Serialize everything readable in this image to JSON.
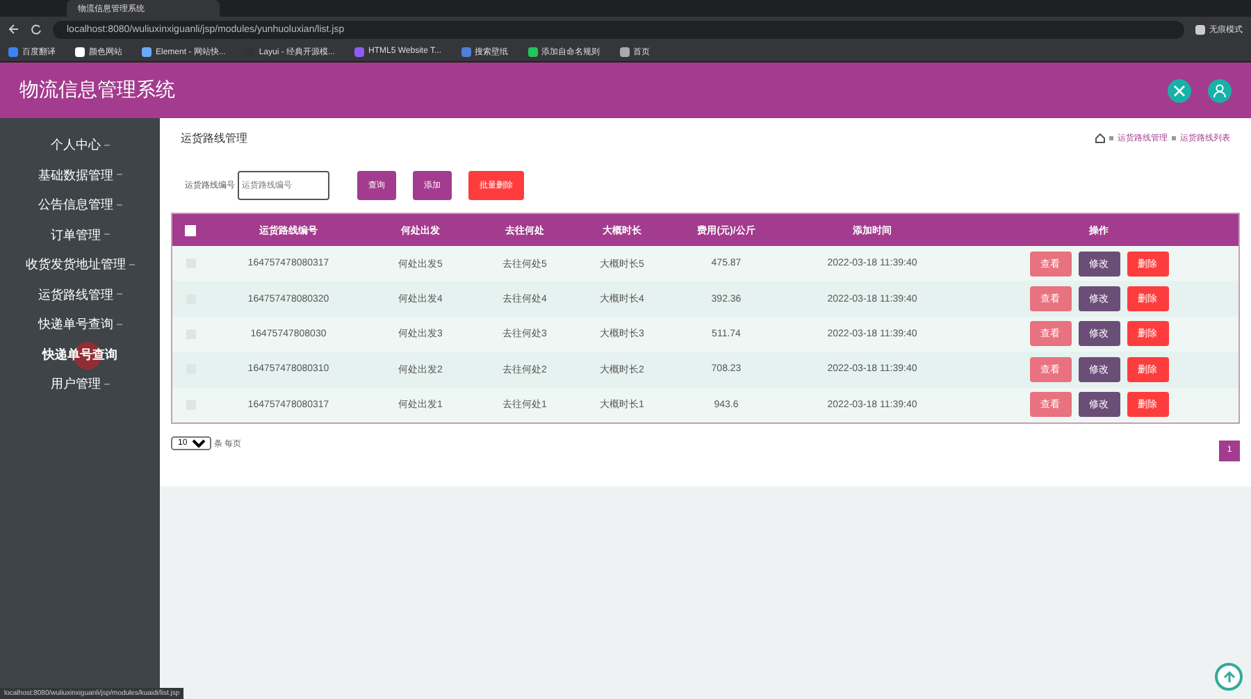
{
  "browser": {
    "tab_title": "物流信息管理系统",
    "address": "localhost:8080/wuliuxinxiguanli/jsp/modules/yunhuoluxian/list.jsp",
    "profile_label": "无痕模式",
    "bookmarks": [
      "百度翻译",
      "颜色网站",
      "Element - 网站快...",
      "Layui - 经典开源模...",
      "HTML5 Website T...",
      "搜索壁纸",
      "添加自命名规则",
      "首页"
    ],
    "status_url": "localhost:8080/wuliuxinxiguanli/jsp/modules/kuaidi/list.jsp"
  },
  "app": {
    "title": "物流信息管理系统",
    "sidebar": {
      "items": [
        {
          "label": "个人中心",
          "hovered": false
        },
        {
          "label": "基础数据管理",
          "hovered": false
        },
        {
          "label": "公告信息管理",
          "hovered": false
        },
        {
          "label": "订单管理",
          "hovered": false
        },
        {
          "label": "收货发货地址管理",
          "hovered": false
        },
        {
          "label": "运货路线管理",
          "hovered": false
        },
        {
          "label": "快递单号查询",
          "hovered": false
        },
        {
          "label": "快递单号查询",
          "hovered": true
        },
        {
          "label": "用户管理",
          "hovered": false
        }
      ]
    },
    "page_title": "运货路线管理",
    "breadcrumb": [
      "运货路线管理",
      "运货路线列表"
    ],
    "search": {
      "label": "运货路线编号",
      "placeholder": "运货路线编号"
    },
    "buttons": [
      {
        "label": "查询",
        "kind": "primary"
      },
      {
        "label": "添加",
        "kind": "primary"
      },
      {
        "label": "批量删除",
        "kind": "danger"
      }
    ],
    "table": {
      "select_all": false,
      "columns": [
        "运货路线编号",
        "何处出发",
        "去往何处",
        "大概时长",
        "费用(元)/公斤",
        "添加时间",
        "操作"
      ],
      "rows": [
        {
          "checked": false,
          "cells": [
            "164757478080317",
            "何处出发5",
            "去往何处5",
            "大概时长5",
            "475.87",
            "2022-03-18 11:39:40"
          ],
          "actions": [
            {
              "label": "查看",
              "kind": "view"
            },
            {
              "label": "修改",
              "kind": "edit"
            },
            {
              "label": "删除",
              "kind": "delete"
            }
          ]
        },
        {
          "checked": false,
          "cells": [
            "164757478080320",
            "何处出发4",
            "去往何处4",
            "大概时长4",
            "392.36",
            "2022-03-18 11:39:40"
          ],
          "actions": [
            {
              "label": "查看",
              "kind": "view"
            },
            {
              "label": "修改",
              "kind": "edit"
            },
            {
              "label": "删除",
              "kind": "delete"
            }
          ]
        },
        {
          "checked": false,
          "cells": [
            "16475747808030",
            "何处出发3",
            "去往何处3",
            "大概时长3",
            "511.74",
            "2022-03-18 11:39:40"
          ],
          "actions": [
            {
              "label": "查看",
              "kind": "view"
            },
            {
              "label": "修改",
              "kind": "edit"
            },
            {
              "label": "删除",
              "kind": "delete"
            }
          ]
        },
        {
          "checked": false,
          "cells": [
            "164757478080310",
            "何处出发2",
            "去往何处2",
            "大概时长2",
            "708.23",
            "2022-03-18 11:39:40"
          ],
          "actions": [
            {
              "label": "查看",
              "kind": "view"
            },
            {
              "label": "修改",
              "kind": "edit"
            },
            {
              "label": "删除",
              "kind": "delete"
            }
          ]
        },
        {
          "checked": false,
          "cells": [
            "164757478080317",
            "何处出发1",
            "去往何处1",
            "大概时长1",
            "943.6",
            "2022-03-18 11:39:40"
          ],
          "actions": [
            {
              "label": "查看",
              "kind": "view"
            },
            {
              "label": "修改",
              "kind": "edit"
            },
            {
              "label": "删除",
              "kind": "delete"
            }
          ]
        }
      ]
    },
    "page_size": "10",
    "page_size_suffix": "条 每页",
    "pages": [
      {
        "label": "1",
        "selected": true
      }
    ]
  }
}
